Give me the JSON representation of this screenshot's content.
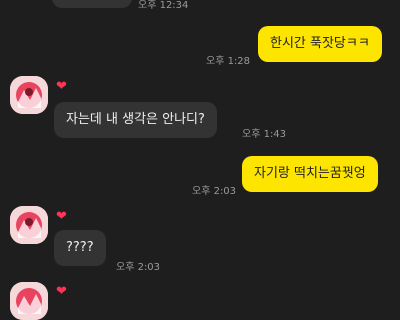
{
  "messages": [
    {
      "sender": "them",
      "text": "",
      "time": "오후 12:34"
    },
    {
      "sender": "me",
      "text": "한시간 푹잣당ㅋㅋ",
      "time": "오후 1:28"
    },
    {
      "sender": "them",
      "text": "자는데 내 생각은 안나디?",
      "time": "오후 1:43",
      "reaction": "❤"
    },
    {
      "sender": "me",
      "text": "자기랑 떡치는꿈꿧엉",
      "time": "오후 2:03"
    },
    {
      "sender": "them",
      "text": "????",
      "time": "오후 2:03",
      "reaction": "❤"
    },
    {
      "sender": "them",
      "text": "",
      "time": "",
      "reaction": "❤"
    }
  ],
  "colors": {
    "background": "#1e1e1e",
    "my_bubble": "#fee500",
    "their_bubble": "#333333",
    "reaction": "#ff3355"
  },
  "icons": {
    "avatar": "profile-avatar",
    "reaction": "heart-icon"
  }
}
